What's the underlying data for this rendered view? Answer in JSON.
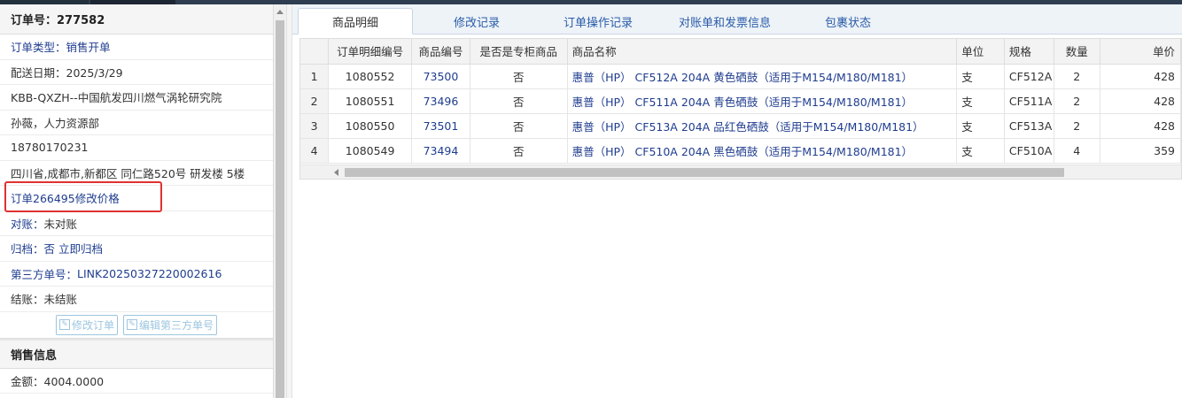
{
  "order": {
    "title": "订单号：277582",
    "type": "订单类型：销售开单",
    "delivery_date": "配送日期：2025/3/29",
    "company": "KBB-QXZH--中国航发四川燃气涡轮研究院",
    "contact": "孙薇，人力资源部",
    "phone": "18780170231",
    "address": "四川省,成都市,新都区 同仁路520号 研发楼 5楼",
    "price_change": "订单266495修改价格",
    "reconcile_label": "对账：",
    "reconcile_value": "未对账",
    "archive_label": "归档：",
    "archive_value": "否 立即归档",
    "third_party_label": "第三方单号：",
    "third_party_value": "LINK20250327220002616",
    "settle": "结账：未结账",
    "edit_order_btn": "修改订单",
    "edit_third_btn": "编辑第三方单号"
  },
  "sales": {
    "title": "销售信息",
    "amount": "金额：4004.0000"
  },
  "tabs": [
    "商品明细",
    "修改记录",
    "订单操作记录",
    "对账单和发票信息",
    "包裹状态"
  ],
  "table": {
    "headers": [
      "",
      "订单明细编号",
      "商品编号",
      "是否是专柜商品",
      "商品名称",
      "单位",
      "规格",
      "数量",
      "单价"
    ],
    "rows": [
      [
        "1",
        "1080552",
        "73500",
        "否",
        "惠普（HP） CF512A 204A 黄色硒鼓（适用于M154/M180/M181）",
        "支",
        "CF512A",
        "2",
        "428"
      ],
      [
        "2",
        "1080551",
        "73496",
        "否",
        "惠普（HP） CF511A 204A 青色硒鼓（适用于M154/M180/M181）",
        "支",
        "CF511A",
        "2",
        "428"
      ],
      [
        "3",
        "1080550",
        "73501",
        "否",
        "惠普（HP） CF513A 204A 品红色硒鼓（适用于M154/M180/M181）",
        "支",
        "CF513A",
        "2",
        "428"
      ],
      [
        "4",
        "1080549",
        "73494",
        "否",
        "惠普（HP） CF510A 204A 黑色硒鼓（适用于M154/M180/M181）",
        "支",
        "CF510A",
        "4",
        "359"
      ]
    ]
  },
  "colors": {
    "link": "#1f3d8f",
    "highlight": "#e03131",
    "tab_text": "#2a5ca8"
  }
}
